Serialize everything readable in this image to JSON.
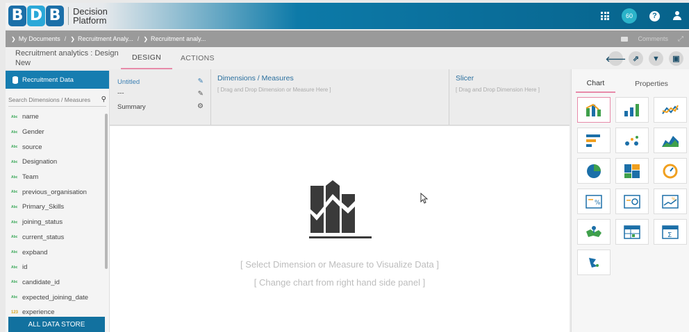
{
  "header": {
    "logo_letters": [
      "B",
      "D",
      "B"
    ],
    "logo_line1": "Decision",
    "logo_line2": "Platform",
    "notification_count": "60",
    "help_glyph": "?",
    "colors": {
      "bar_start": "#0d7aa8",
      "logo_blue": "#1b6fa8",
      "logo_cyan": "#2aa8d8",
      "accent_pink": "#e78aa9"
    }
  },
  "breadcrumb": {
    "items": [
      "My Documents",
      "Recruitment Analy...",
      "Recruitment analy..."
    ],
    "separator": "/",
    "comments_label": "Comments"
  },
  "toolbar": {
    "doc_title": "Recruitment analytics : Design New",
    "tabs": [
      "DESIGN",
      "ACTIONS"
    ],
    "active_tab": "DESIGN",
    "buttons": [
      "back-icon",
      "export-icon",
      "filter-icon",
      "save-icon"
    ]
  },
  "sidebar": {
    "title": "Recruitment Data",
    "search_placeholder": "Search Dimensions / Measures",
    "type_badge_text": "Abc",
    "numeric_badge_text": "123",
    "fields": [
      {
        "type": "Abc",
        "name": "name"
      },
      {
        "type": "Abc",
        "name": "Gender"
      },
      {
        "type": "Abc",
        "name": "source"
      },
      {
        "type": "Abc",
        "name": "Designation"
      },
      {
        "type": "Abc",
        "name": "Team"
      },
      {
        "type": "Abc",
        "name": "previous_organisation"
      },
      {
        "type": "Abc",
        "name": "Primary_Skills"
      },
      {
        "type": "Abc",
        "name": "joining_status"
      },
      {
        "type": "Abc",
        "name": "current_status"
      },
      {
        "type": "Abc",
        "name": "expband"
      },
      {
        "type": "Abc",
        "name": "id"
      },
      {
        "type": "Abc",
        "name": "candidate_id"
      },
      {
        "type": "Abc",
        "name": "expected_joining_date"
      },
      {
        "type": "123",
        "name": "experience"
      }
    ],
    "footer_button": "ALL DATA STORE"
  },
  "zones": {
    "properties": {
      "title": "Untitled",
      "subtitle": "---",
      "summary": "Summary"
    },
    "dimensions": {
      "title": "Dimensions / Measures",
      "hint": "[ Drag and Drop Dimension or Measure Here ]"
    },
    "slicer": {
      "title": "Slicer",
      "hint": "[ Drag and Drop Dimension Here ]"
    }
  },
  "canvas": {
    "message1": "[ Select Dimension or Measure to Visualize Data ]",
    "message2": "[ Change chart from right hand side panel ]"
  },
  "right_panel": {
    "tabs": [
      "Chart",
      "Properties"
    ],
    "active_tab": "Chart",
    "chart_types": [
      "mixed-chart-icon",
      "column-chart-icon",
      "line-chart-icon",
      "bar-chart-icon",
      "scatter-chart-icon",
      "area-chart-icon",
      "pie-chart-icon",
      "treemap-icon",
      "gauge-icon",
      "kpi-percent-icon",
      "kpi-card-icon",
      "kpi-trend-icon",
      "map-icon",
      "table-icon",
      "pivot-summary-icon",
      "custom-chart-icon"
    ],
    "selected_chart": "mixed-chart-icon"
  }
}
